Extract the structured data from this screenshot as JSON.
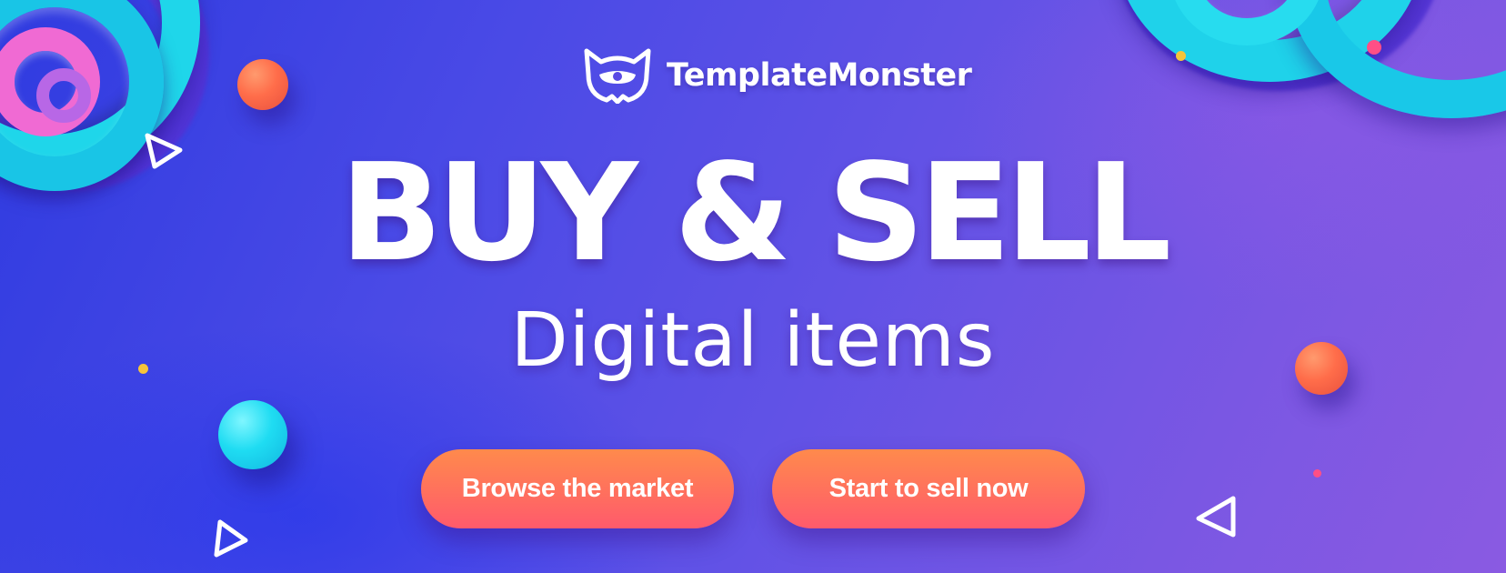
{
  "brand": {
    "name": "TemplateMonster",
    "logo_icon": "monster-face-icon"
  },
  "hero": {
    "headline": "BUY & SELL",
    "subheadline": "Digital items"
  },
  "actions": {
    "browse_label": "Browse the market",
    "sell_label": "Start to sell now"
  },
  "colors": {
    "background_start": "#2f3be0",
    "background_end": "#8a5ae2",
    "button_top": "#ff8a4c",
    "button_bottom": "#ff5a6c",
    "accent_cyan": "#1fd6ea",
    "accent_pink": "#f06ad3",
    "accent_orange": "#ff6d4a",
    "accent_yellow": "#f7c43a",
    "text": "#ffffff"
  },
  "decorations": {
    "icons": [
      "triangle-outline-icon",
      "sphere-icon",
      "swirl-icon",
      "dot-icon"
    ]
  }
}
